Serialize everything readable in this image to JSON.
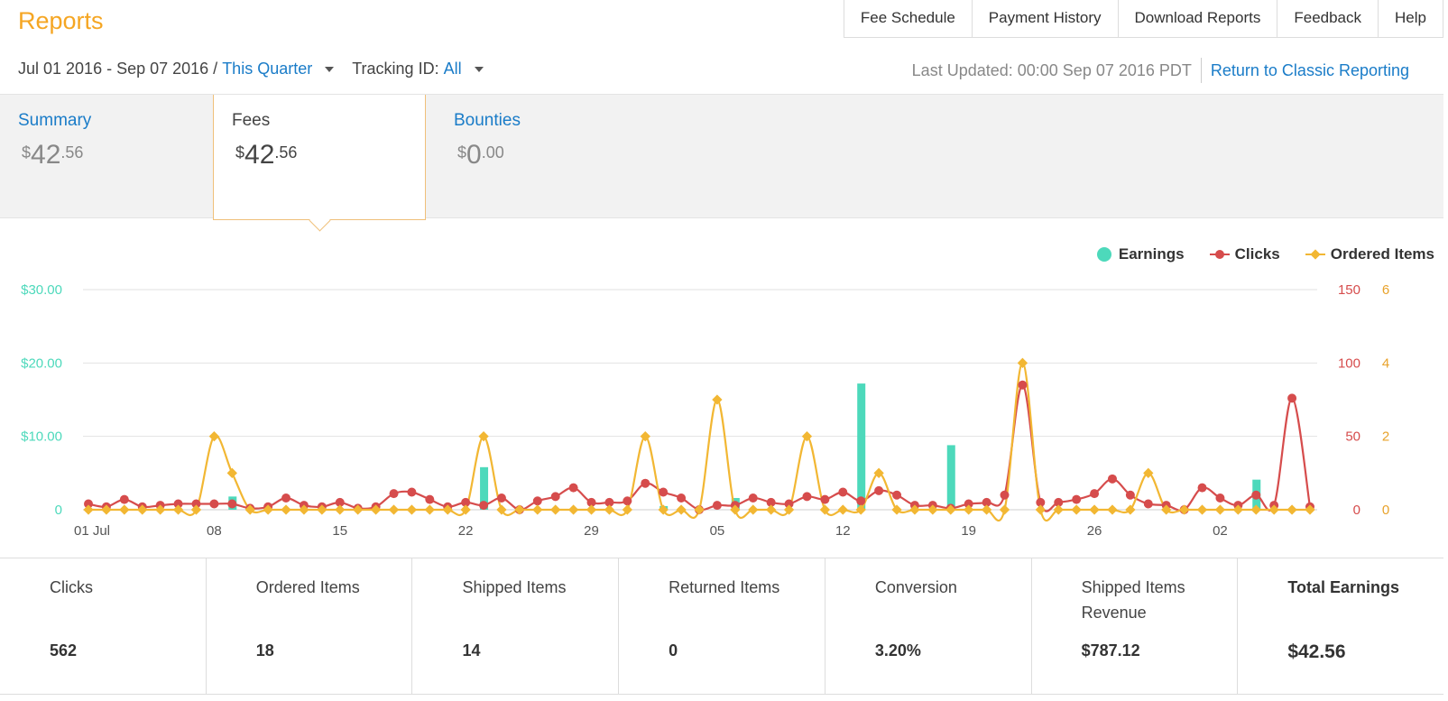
{
  "header": {
    "title": "Reports",
    "top_links": [
      "Fee Schedule",
      "Payment History",
      "Download Reports",
      "Feedback",
      "Help"
    ],
    "date_range": "Jul 01 2016 - Sep 07 2016 /",
    "period": "This Quarter",
    "tracking_label": "Tracking ID:",
    "tracking_value": "All",
    "last_updated": "Last Updated: 00:00 Sep 07 2016 PDT",
    "classic_link": "Return to Classic Reporting"
  },
  "tabs": [
    {
      "label": "Summary",
      "currency": "$",
      "whole": "42",
      "cents": ".56"
    },
    {
      "label": "Fees",
      "currency": "$",
      "whole": "42",
      "cents": ".56"
    },
    {
      "label": "Bounties",
      "currency": "$",
      "whole": "0",
      "cents": ".00"
    }
  ],
  "legend": {
    "earnings": "Earnings",
    "clicks": "Clicks",
    "ordered": "Ordered Items"
  },
  "colors": {
    "earnings": "#4dd9bb",
    "clicks": "#d64c4c",
    "ordered": "#f2b733",
    "accent": "#f5a623",
    "link": "#1a7cc8"
  },
  "chart_data": {
    "type": "line",
    "x_ticks": [
      "01 Jul",
      "08",
      "15",
      "22",
      "29",
      "05",
      "12",
      "19",
      "26",
      "02"
    ],
    "y_left_ticks": [
      "0",
      "$10.00",
      "$20.00",
      "$30.00"
    ],
    "y_right_clicks_ticks": [
      "0",
      "50",
      "100",
      "150"
    ],
    "y_right_items_ticks": [
      "0",
      "2",
      "4",
      "6"
    ],
    "ylim_earnings": [
      0,
      30
    ],
    "ylim_clicks": [
      0,
      150
    ],
    "ylim_items": [
      0,
      6
    ],
    "grid": true,
    "legend_position": "top-right",
    "series": [
      {
        "name": "Earnings",
        "kind": "bar",
        "values": [
          0,
          0,
          0,
          0,
          0,
          0,
          0,
          0,
          1.8,
          0,
          0,
          0,
          0,
          0,
          0,
          0,
          0,
          0,
          0,
          0,
          0,
          0,
          5.8,
          0,
          0,
          0,
          0,
          0,
          0,
          0,
          0,
          0,
          0.5,
          0,
          0,
          0,
          1.6,
          0,
          0,
          0,
          0,
          0,
          0,
          17.2,
          0,
          0,
          0,
          0,
          8.8,
          0,
          0,
          0,
          0,
          0,
          0,
          0,
          0,
          0,
          0,
          0,
          0,
          0,
          0,
          0,
          0,
          4.1,
          0,
          0,
          0,
          0,
          0,
          0,
          0,
          0
        ]
      },
      {
        "name": "Clicks",
        "kind": "line",
        "values": [
          4,
          2,
          7,
          2,
          3,
          4,
          4,
          4,
          4,
          1,
          2,
          8,
          3,
          2,
          5,
          1,
          2,
          11,
          12,
          7,
          2,
          5,
          3,
          8,
          0,
          6,
          9,
          15,
          5,
          5,
          6,
          18,
          12,
          8,
          0,
          3,
          3,
          8,
          5,
          4,
          9,
          7,
          12,
          6,
          13,
          10,
          3,
          3,
          1,
          4,
          5,
          10,
          85,
          5,
          5,
          7,
          11,
          21,
          10,
          4,
          3,
          0,
          15,
          8,
          3,
          10,
          3,
          76,
          2
        ]
      },
      {
        "name": "Ordered Items",
        "kind": "line",
        "values": [
          0,
          0,
          0,
          0,
          0,
          0,
          0,
          2,
          1,
          0,
          0,
          0,
          0,
          0,
          0,
          0,
          0,
          0,
          0,
          0,
          0,
          0,
          2,
          0,
          0,
          0,
          0,
          0,
          0,
          0,
          0,
          2,
          0,
          0,
          0,
          3,
          0,
          0,
          0,
          0,
          2,
          0,
          0,
          0,
          1,
          0,
          0,
          0,
          0,
          0,
          0,
          0,
          4,
          0,
          0,
          0,
          0,
          0,
          0,
          1,
          0,
          0,
          0,
          0,
          0,
          0,
          0,
          0,
          0
        ]
      }
    ]
  },
  "stats": [
    {
      "label": "Clicks",
      "value": "562"
    },
    {
      "label": "Ordered Items",
      "value": "18"
    },
    {
      "label": "Shipped Items",
      "value": "14"
    },
    {
      "label": "Returned Items",
      "value": "0"
    },
    {
      "label": "Conversion",
      "value": "3.20%"
    },
    {
      "label": "Shipped Items Revenue",
      "value": "$787.12"
    },
    {
      "label": "Total Earnings",
      "value": "$42.56"
    }
  ]
}
